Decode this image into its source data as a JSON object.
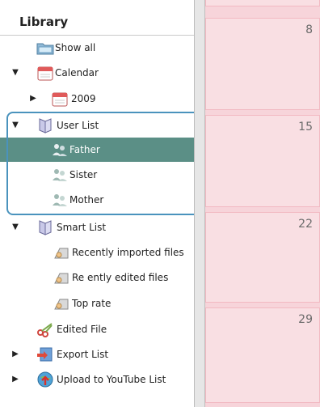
{
  "sidebar": {
    "title": "Library",
    "items": [
      {
        "label": "Show all",
        "icon": "folder-icon"
      },
      {
        "label": "Calendar",
        "icon": "calendar-icon",
        "expanded": true
      },
      {
        "label": "2009",
        "icon": "calendar-icon",
        "expanded": false
      },
      {
        "label": "User List",
        "icon": "book-icon",
        "expanded": true
      },
      {
        "label": "Father",
        "icon": "people-icon",
        "selected": true
      },
      {
        "label": "Sister",
        "icon": "people-icon"
      },
      {
        "label": "Mother",
        "icon": "people-icon"
      },
      {
        "label": "Smart List",
        "icon": "book-icon",
        "expanded": true
      },
      {
        "label": "Recently imported files",
        "icon": "filter-icon"
      },
      {
        "label": "Re ently edited files",
        "icon": "filter-icon"
      },
      {
        "label": "Top rate",
        "icon": "filter-icon"
      },
      {
        "label": "Edited File",
        "icon": "scissors-icon"
      },
      {
        "label": "Export List",
        "icon": "export-icon",
        "expanded": false
      },
      {
        "label": "Upload to YouTube List",
        "icon": "upload-globe-icon",
        "expanded": false
      }
    ]
  },
  "calendar": {
    "days": [
      "8",
      "15",
      "22",
      "29"
    ]
  },
  "colors": {
    "selection": "#5b8f86",
    "highlight_frame": "#4a93bd",
    "calendar_bg": "#f7d4da"
  }
}
